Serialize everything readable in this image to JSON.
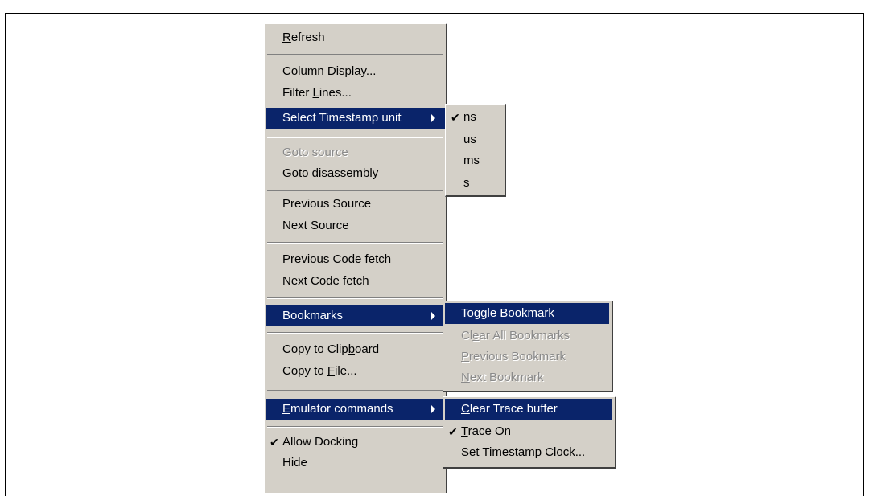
{
  "main_menu": {
    "items": {
      "refresh": {
        "pre": "",
        "key": "R",
        "post": "efresh"
      },
      "column_display": {
        "pre": "",
        "key": "C",
        "post": "olumn Display..."
      },
      "filter_lines": {
        "pre": "Filter ",
        "key": "L",
        "post": "ines..."
      },
      "select_timestamp": "Select Timestamp unit",
      "goto_source": "Goto source",
      "goto_disassembly": "Goto disassembly",
      "previous_source": "Previous Source",
      "next_source": "Next Source",
      "previous_code_fetch": "Previous Code fetch",
      "next_code_fetch": "Next Code fetch",
      "bookmarks": "Bookmarks",
      "copy_clipboard": {
        "pre": "Copy to Clip",
        "key": "b",
        "post": "oard"
      },
      "copy_file": {
        "pre": "Copy to ",
        "key": "F",
        "post": "ile..."
      },
      "emulator_commands": {
        "pre": "",
        "key": "E",
        "post": "mulator commands"
      },
      "allow_docking": "Allow Docking",
      "hide": "Hide"
    },
    "check_glyph": "✔"
  },
  "timestamp_submenu": {
    "units": [
      "ns",
      "us",
      "ms",
      "s"
    ],
    "selected": "ns"
  },
  "bookmarks_submenu": {
    "toggle": {
      "pre": "",
      "key": "T",
      "post": "oggle Bookmark"
    },
    "clear_all": {
      "pre": "Cl",
      "key": "e",
      "post": "ar All Bookmarks"
    },
    "previous": {
      "pre": "",
      "key": "P",
      "post": "revious Bookmark"
    },
    "next": {
      "pre": "",
      "key": "N",
      "post": "ext Bookmark"
    }
  },
  "emulator_submenu": {
    "clear_trace": {
      "pre": "",
      "key": "C",
      "post": "lear Trace buffer"
    },
    "trace_on": {
      "pre": "",
      "key": "T",
      "post": "race On"
    },
    "set_timestamp_clock": {
      "pre": "",
      "key": "S",
      "post": "et Timestamp Clock..."
    }
  },
  "colors": {
    "menu_bg": "#d4d0c8",
    "highlight": "#0a246a",
    "disabled_text": "#8a8a8a"
  }
}
